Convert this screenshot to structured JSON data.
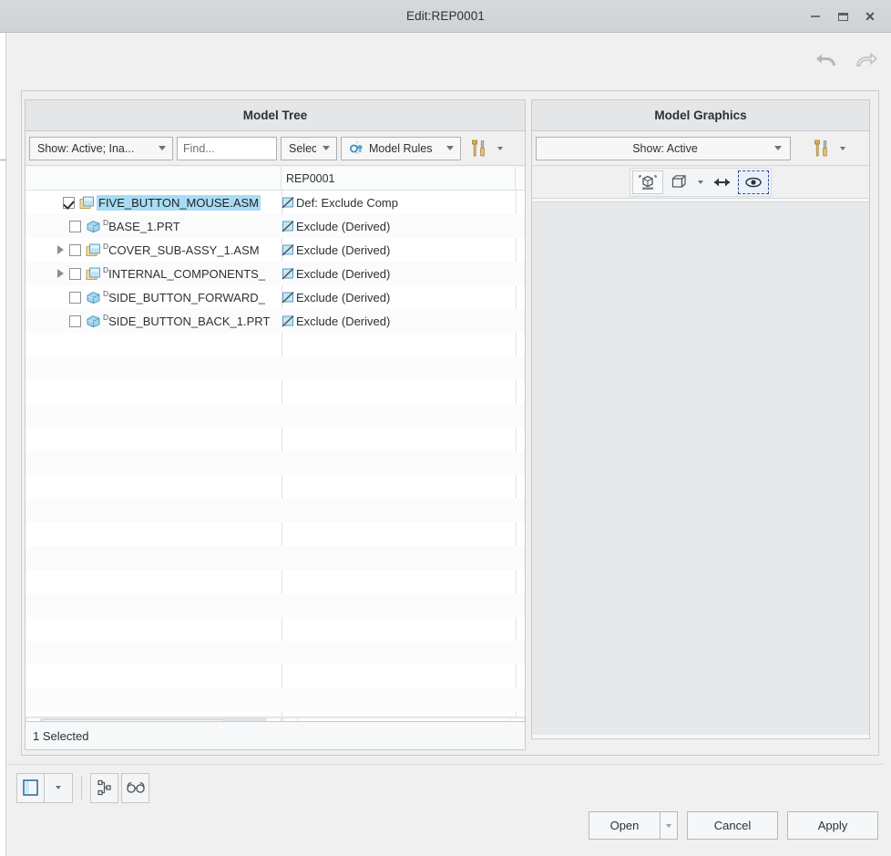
{
  "window": {
    "title": "Edit:REP0001",
    "minimize_label": "Minimize",
    "maximize_label": "Maximize",
    "close_label": "Close"
  },
  "toolbar": {
    "undo_label": "Undo",
    "redo_label": "Redo"
  },
  "model_tree": {
    "panel_title": "Model Tree",
    "show_filter": "Show: Active; Ina...",
    "find_placeholder": "Find...",
    "find_value": "",
    "select_label": "Select",
    "model_rules_label": "Model Rules",
    "columns": [
      "",
      "REP0001",
      ""
    ],
    "rows": [
      {
        "indent": 0,
        "has_twisty": false,
        "checked": true,
        "icon": "assembly-icon",
        "derived_mark": "",
        "name": "FIVE_BUTTON_MOUSE.ASM",
        "selected": true,
        "status_icon": "exclude-icon",
        "status": "Def: Exclude Comp"
      },
      {
        "indent": 1,
        "has_twisty": false,
        "checked": false,
        "icon": "part-icon",
        "derived_mark": "D",
        "name": "BASE_1.PRT",
        "selected": false,
        "status_icon": "exclude-icon",
        "status": "Exclude (Derived)"
      },
      {
        "indent": 1,
        "has_twisty": true,
        "checked": false,
        "icon": "assembly-icon",
        "derived_mark": "D",
        "name": "COVER_SUB-ASSY_1.ASM",
        "selected": false,
        "status_icon": "exclude-icon",
        "status": "Exclude (Derived)"
      },
      {
        "indent": 1,
        "has_twisty": true,
        "checked": false,
        "icon": "assembly-icon",
        "derived_mark": "D",
        "name": "INTERNAL_COMPONENTS_",
        "selected": false,
        "status_icon": "exclude-icon",
        "status": "Exclude (Derived)"
      },
      {
        "indent": 1,
        "has_twisty": false,
        "checked": false,
        "icon": "part-icon",
        "derived_mark": "D",
        "name": "SIDE_BUTTON_FORWARD_",
        "selected": false,
        "status_icon": "exclude-icon",
        "status": "Exclude (Derived)"
      },
      {
        "indent": 1,
        "has_twisty": false,
        "checked": false,
        "icon": "part-icon",
        "derived_mark": "D",
        "name": "SIDE_BUTTON_BACK_1.PRT",
        "selected": false,
        "status_icon": "exclude-icon",
        "status": "Exclude (Derived)"
      }
    ],
    "status_text": "1 Selected"
  },
  "model_graphics": {
    "panel_title": "Model Graphics",
    "show_filter": "Show: Active",
    "view_buttons": [
      {
        "name": "exploded-view-icon",
        "active": false
      },
      {
        "name": "display-style-icon",
        "active": false
      },
      {
        "name": "resize-icon",
        "active": false
      },
      {
        "name": "visibility-eye-icon",
        "active": true
      }
    ]
  },
  "bottom_bar": {
    "tools": [
      {
        "name": "panel-layout-icon"
      },
      {
        "name": "tree-nodes-icon"
      },
      {
        "name": "glasses-icon"
      }
    ],
    "open_label": "Open",
    "cancel_label": "Cancel",
    "apply_label": "Apply"
  },
  "colors": {
    "selection_highlight": "#a9dcf4",
    "accent_blue": "#2b4d8e",
    "titlebar": "#d4d7da",
    "panel_header": "#e4e6e8"
  }
}
